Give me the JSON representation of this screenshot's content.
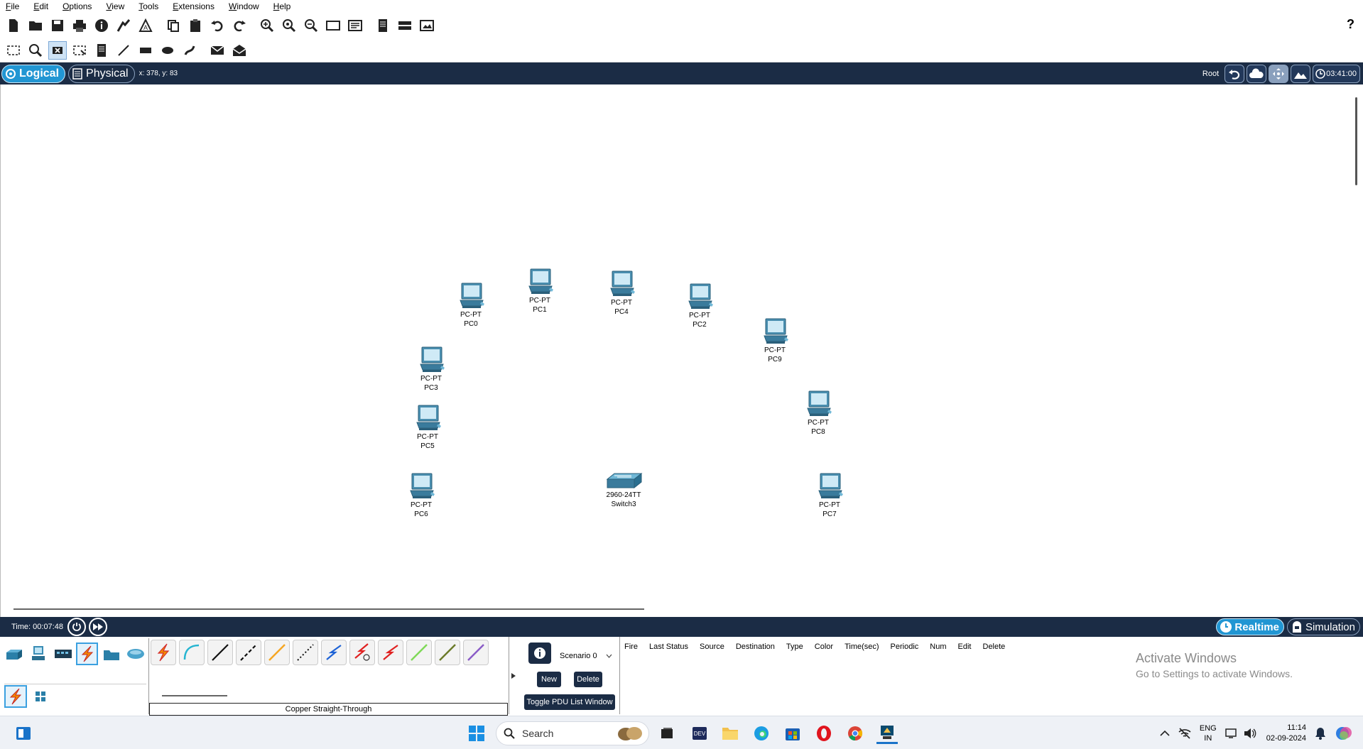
{
  "menu": [
    "File",
    "Edit",
    "Options",
    "View",
    "Tools",
    "Extensions",
    "Window",
    "Help"
  ],
  "toolbar": {
    "help_label": "?"
  },
  "nav": {
    "logical_label": "Logical",
    "physical_label": "Physical",
    "cursor_coords": "x: 378, y: 83",
    "root_label": "Root",
    "clock": "03:41:00"
  },
  "devices": [
    {
      "model": "PC-PT",
      "name": "PC0"
    },
    {
      "model": "PC-PT",
      "name": "PC1"
    },
    {
      "model": "PC-PT",
      "name": "PC4"
    },
    {
      "model": "PC-PT",
      "name": "PC2"
    },
    {
      "model": "PC-PT",
      "name": "PC9"
    },
    {
      "model": "PC-PT",
      "name": "PC3"
    },
    {
      "model": "PC-PT",
      "name": "PC5"
    },
    {
      "model": "PC-PT",
      "name": "PC8"
    },
    {
      "model": "PC-PT",
      "name": "PC6"
    },
    {
      "model": "2960-24TT",
      "name": "Switch3"
    },
    {
      "model": "PC-PT",
      "name": "PC7"
    }
  ],
  "timebar": {
    "time": "Time: 00:07:48",
    "realtime_label": "Realtime",
    "simulation_label": "Simulation"
  },
  "connections": {
    "selected_label": "Copper Straight-Through"
  },
  "scenario": {
    "select_value": "Scenario 0",
    "new_label": "New",
    "delete_label": "Delete",
    "toggle_label": "Toggle PDU List Window"
  },
  "pdu_columns": [
    "Fire",
    "Last Status",
    "Source",
    "Destination",
    "Type",
    "Color",
    "Time(sec)",
    "Periodic",
    "Num",
    "Edit",
    "Delete"
  ],
  "watermark": {
    "title": "Activate Windows",
    "subtitle": "Go to Settings to activate Windows."
  },
  "taskbar": {
    "search_placeholder": "Search",
    "lang_top": "ENG",
    "lang_bottom": "IN",
    "time": "11:14",
    "date": "02-09-2024"
  },
  "colors": {
    "nav_bg": "#1b2c45",
    "accent": "#2196d3"
  }
}
